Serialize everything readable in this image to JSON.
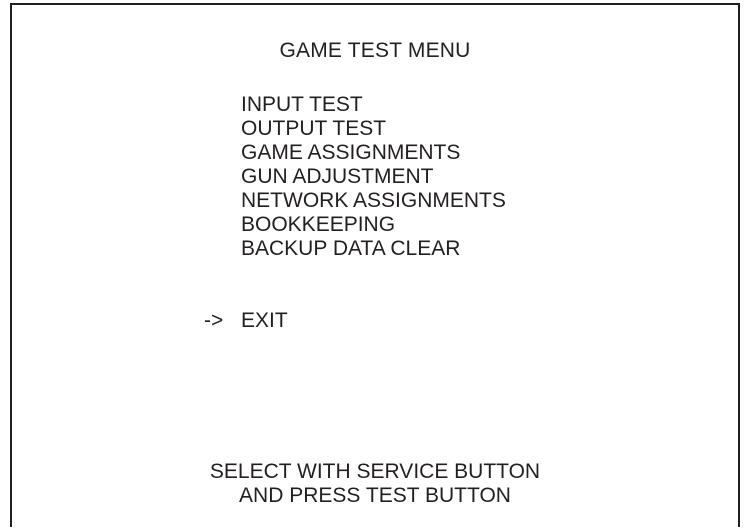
{
  "title": "GAME TEST MENU",
  "menu_items": [
    "INPUT TEST",
    "OUTPUT TEST",
    "GAME ASSIGNMENTS",
    "GUN ADJUSTMENT",
    "NETWORK ASSIGNMENTS",
    "BOOKKEEPING",
    "BACKUP DATA CLEAR"
  ],
  "selection_cursor": "->",
  "exit_label": "EXIT",
  "instructions": [
    "SELECT WITH SERVICE BUTTON",
    "AND PRESS TEST BUTTON"
  ],
  "colors": {
    "background": "#ffffff",
    "text": "#231f20",
    "border": "#231f20"
  }
}
